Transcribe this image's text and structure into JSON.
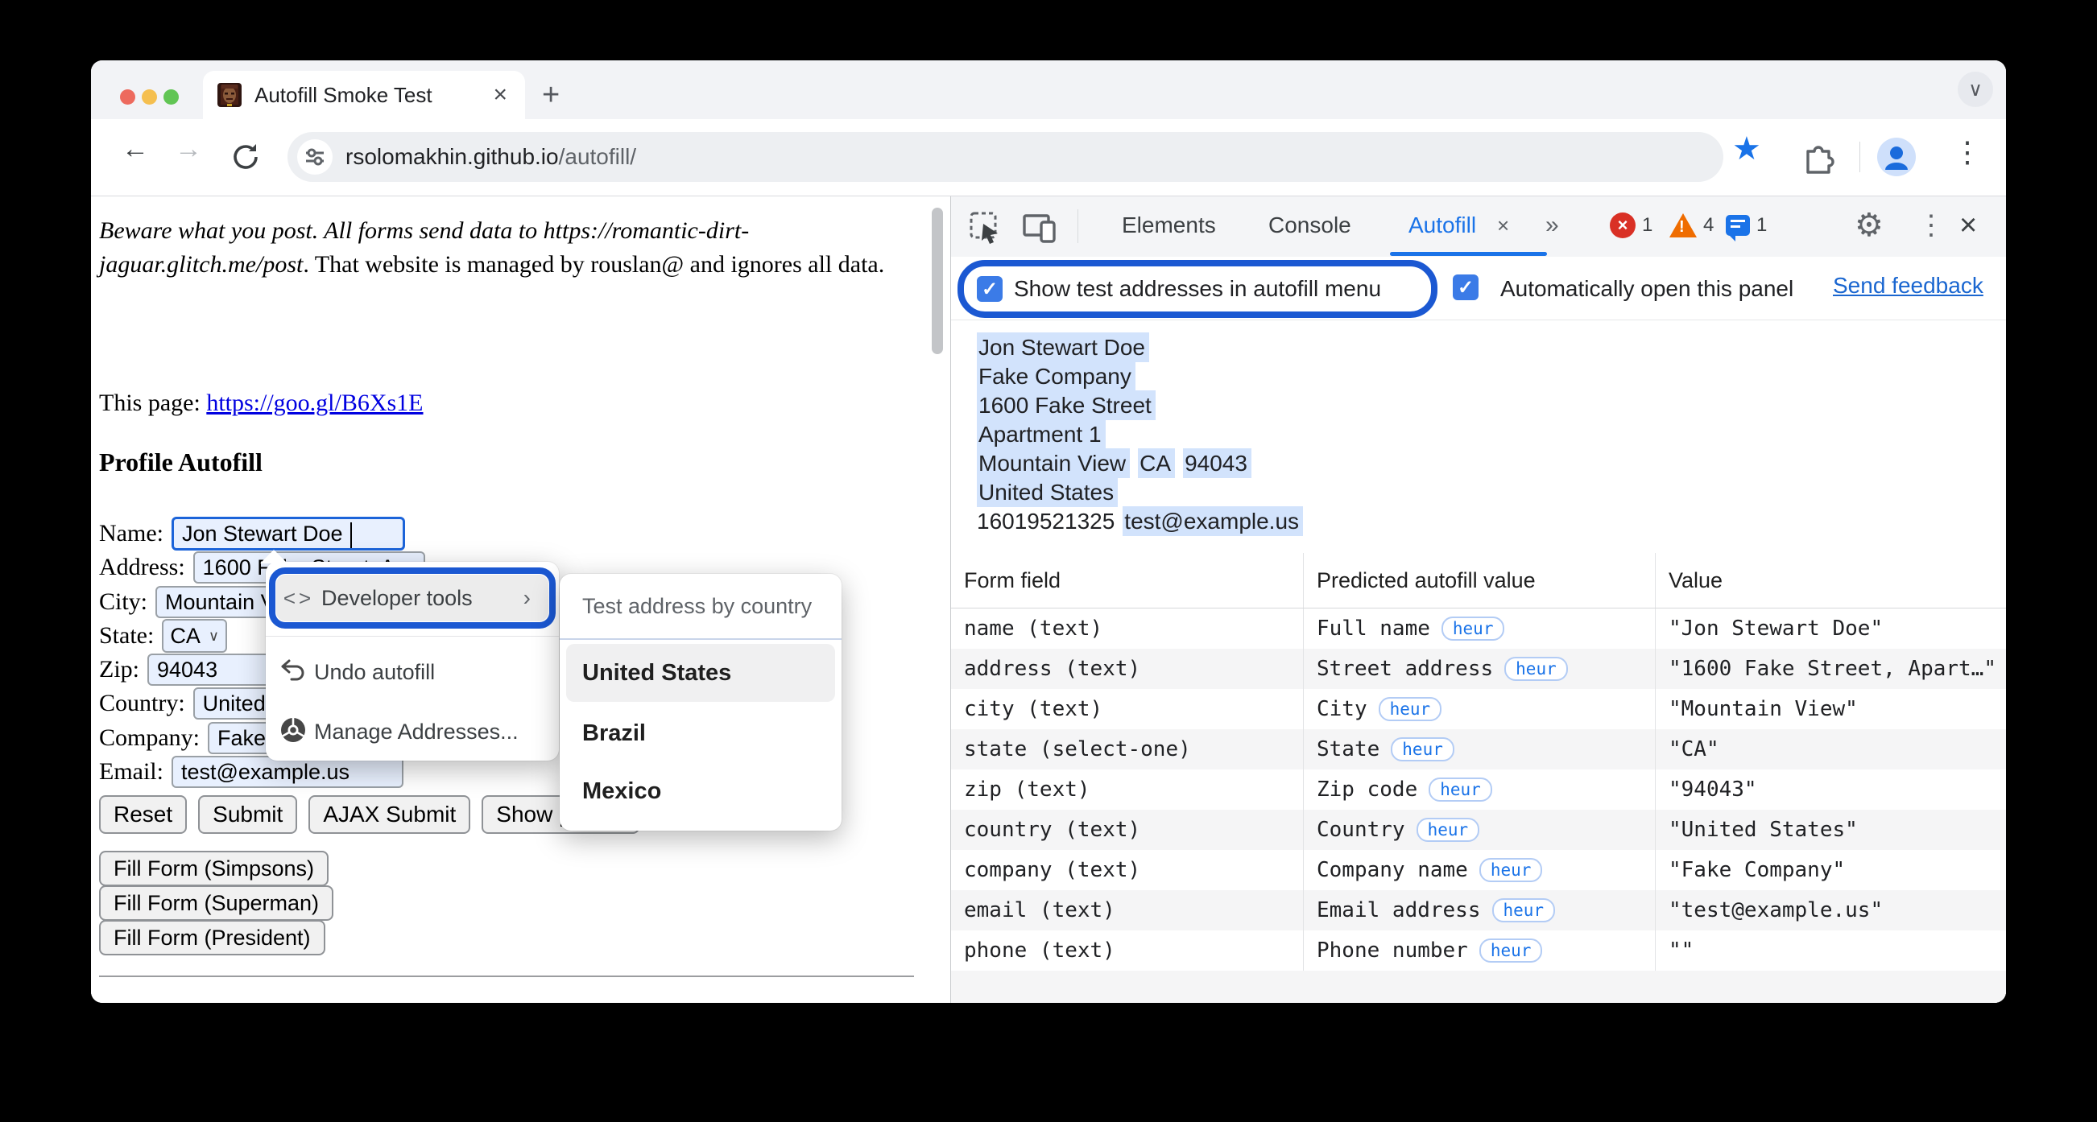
{
  "icons": {
    "close": "×",
    "plus": "+",
    "back": "←",
    "forward": "→",
    "star": "★",
    "kebab": "⋮",
    "gear": "⚙",
    "chevron_down": "∨",
    "more_tabs": "»",
    "code": "<>",
    "submenu_arrow": "›",
    "select_chevron": "∨",
    "check": "✓",
    "exclaim": "!"
  },
  "browser": {
    "tab_title": "Autofill Smoke Test",
    "url_host": "rsolomakhin.github.io",
    "url_path": "/autofill/"
  },
  "page": {
    "warning_italic": "Beware what you post. All forms send data to https://romantic-dirt-jaguar.glitch.me/post",
    "warning_rest": ". That website is managed by rouslan@ and ignores all data.",
    "this_page_label": "This page: ",
    "this_page_link": "https://goo.gl/B6Xs1E",
    "heading": "Profile Autofill",
    "form": {
      "rows": [
        {
          "label": "Name:",
          "value": "Jon Stewart Doe"
        },
        {
          "label": "Address:",
          "value": "1600 Fake Street, Apart"
        },
        {
          "label": "City:",
          "value": "Mountain View"
        },
        {
          "label": "State:",
          "value": "CA"
        },
        {
          "label": "Zip:",
          "value": "94043"
        },
        {
          "label": "Country:",
          "value": "United States"
        },
        {
          "label": "Company:",
          "value": "Fake Company"
        },
        {
          "label": "Email:",
          "value": "test@example.us"
        }
      ],
      "buttons": [
        "Reset",
        "Submit",
        "AJAX Submit",
        "Show pho"
      ],
      "fill_buttons": [
        "Fill Form (Simpsons)",
        "Fill Form (Superman)",
        "Fill Form (President)"
      ]
    }
  },
  "context_menu": {
    "developer_tools": "Developer tools",
    "undo_autofill": "Undo autofill",
    "manage_addresses": "Manage Addresses..."
  },
  "submenu": {
    "header": "Test address by country",
    "items": [
      "United States",
      "Brazil",
      "Mexico"
    ]
  },
  "devtools": {
    "tabs": [
      "Elements",
      "Console",
      "Autofill"
    ],
    "error_count": "1",
    "warning_count": "4",
    "issue_count": "1",
    "show_test_label": "Show test addresses in autofill menu",
    "auto_open_label": "Automatically open this panel",
    "send_feedback": "Send feedback",
    "address_preview": {
      "name": "Jon Stewart Doe",
      "company": "Fake Company",
      "street": "1600 Fake Street",
      "apt": "Apartment 1",
      "city": "Mountain View",
      "state": "CA",
      "zip": "94043",
      "country": "United States",
      "phone": "16019521325",
      "email": "test@example.us"
    },
    "table": {
      "headers": [
        "Form field",
        "Predicted autofill value",
        "Value"
      ],
      "badge": "heur",
      "rows": [
        {
          "field": "name (text)",
          "predicted": "Full name",
          "value": "\"Jon Stewart Doe\""
        },
        {
          "field": "address (text)",
          "predicted": "Street address",
          "value": "\"1600 Fake Street, Apart…\""
        },
        {
          "field": "city (text)",
          "predicted": "City",
          "value": "\"Mountain View\""
        },
        {
          "field": "state (select-one)",
          "predicted": "State",
          "value": "\"CA\""
        },
        {
          "field": "zip (text)",
          "predicted": "Zip code",
          "value": "\"94043\""
        },
        {
          "field": "country (text)",
          "predicted": "Country",
          "value": "\"United States\""
        },
        {
          "field": "company (text)",
          "predicted": "Company name",
          "value": "\"Fake Company\""
        },
        {
          "field": "email (text)",
          "predicted": "Email address",
          "value": "\"test@example.us\""
        },
        {
          "field": "phone (text)",
          "predicted": "Phone number",
          "value": "\"\""
        }
      ]
    }
  }
}
